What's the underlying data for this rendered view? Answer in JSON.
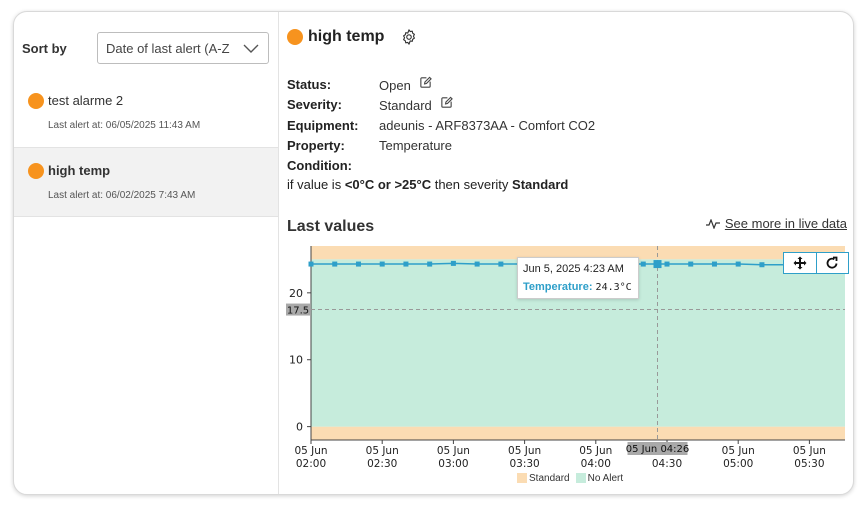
{
  "sidebar": {
    "sort_label": "Sort by",
    "sort_value": "Date of last alert (A-Z",
    "alerts": [
      {
        "name": "test alarme 2",
        "last_alert": "Last alert at: 06/05/2025 11:43 AM",
        "status_color": "#f7931e",
        "selected": false
      },
      {
        "name": "high temp",
        "last_alert": "Last alert at: 06/02/2025 7:43 AM",
        "status_color": "#f7931e",
        "selected": true
      }
    ]
  },
  "detail": {
    "title": "high temp",
    "status_label": "Status:",
    "status_value": "Open",
    "severity_label": "Severity:",
    "severity_value": "Standard",
    "equipment_label": "Equipment:",
    "equipment_value": "adeunis - ARF8373AA - Comfort CO2",
    "property_label": "Property:",
    "property_value": "Temperature",
    "condition_label": "Condition:",
    "condition_prefix": "if value is ",
    "condition_range": "<0°C or >25°C",
    "condition_middle": " then severity ",
    "condition_severity": "Standard",
    "last_values_title": "Last values",
    "live_data_link": "See more in live data"
  },
  "chart_data": {
    "type": "line",
    "series": [
      {
        "name": "Temperature",
        "color": "#2e9fc9",
        "x": [
          "02:00",
          "02:10",
          "02:20",
          "02:30",
          "02:40",
          "02:50",
          "03:00",
          "03:10",
          "03:20",
          "03:30",
          "03:40",
          "03:50",
          "04:00",
          "04:10",
          "04:20",
          "04:26",
          "04:30",
          "04:40",
          "04:50",
          "05:00",
          "05:10",
          "05:20",
          "05:30",
          "05:40"
        ],
        "values": [
          24.3,
          24.3,
          24.3,
          24.3,
          24.3,
          24.3,
          24.4,
          24.3,
          24.3,
          24.3,
          24.3,
          24.3,
          24.3,
          24.3,
          24.3,
          24.3,
          24.3,
          24.3,
          24.3,
          24.3,
          24.2,
          24.2,
          24.0,
          23.9
        ]
      }
    ],
    "x_ticks": [
      {
        "t": "02:00",
        "l1": "05 Jun",
        "l2": "02:00"
      },
      {
        "t": "02:30",
        "l1": "05 Jun",
        "l2": "02:30"
      },
      {
        "t": "03:00",
        "l1": "05 Jun",
        "l2": "03:00"
      },
      {
        "t": "03:30",
        "l1": "05 Jun",
        "l2": "03:30"
      },
      {
        "t": "04:00",
        "l1": "05 Jun",
        "l2": "04:00"
      },
      {
        "t": "04:30",
        "l1": "",
        "l2": "04:30"
      },
      {
        "t": "05:00",
        "l1": "05 Jun",
        "l2": "05:00"
      },
      {
        "t": "05:30",
        "l1": "05 Jun",
        "l2": "05:30"
      }
    ],
    "y_ticks": [
      0,
      10,
      20
    ],
    "ylim": [
      -2,
      27
    ],
    "xlim": [
      "02:00",
      "05:45"
    ],
    "bands": [
      {
        "name": "Standard",
        "color": "#fbdcb3",
        "ranges": [
          [
            -2,
            0
          ],
          [
            25,
            27
          ]
        ]
      },
      {
        "name": "No Alert",
        "color": "#c6ecdc",
        "ranges": [
          [
            0,
            25
          ]
        ]
      }
    ],
    "crosshair": {
      "x": "04:26",
      "x_label": "05 Jun 04:26",
      "y": 17.5,
      "y_label": "17.5"
    },
    "tooltip": {
      "date": "Jun 5, 2025 4:23 AM",
      "series_label": "Temperature:",
      "value": "24.3°C"
    },
    "legend": [
      "Standard",
      "No Alert"
    ],
    "grid": false
  }
}
